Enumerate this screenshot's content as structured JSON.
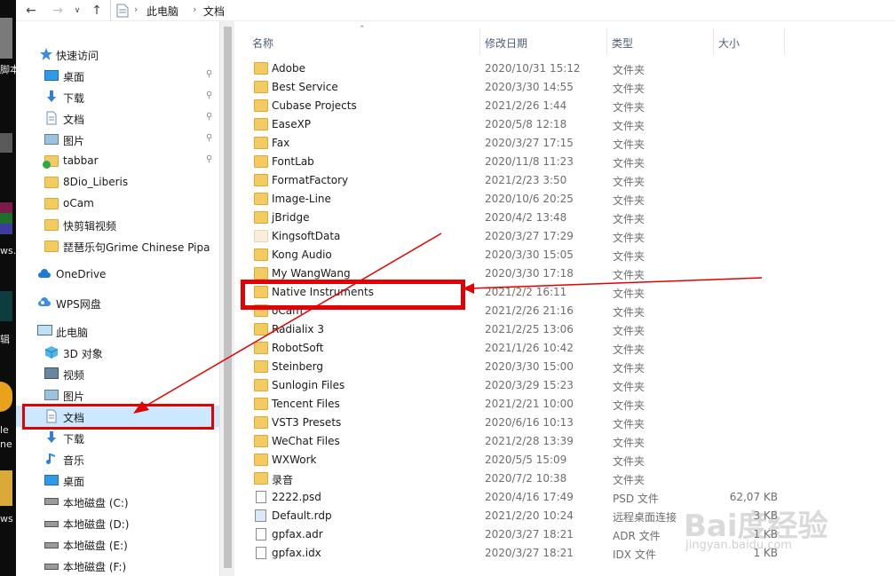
{
  "desktop": {
    "fragments": [
      "脚本",
      "ws...",
      "辑",
      "le",
      "ne",
      "ws"
    ]
  },
  "address": {
    "crumbs": [
      "此电脑",
      "文档"
    ]
  },
  "nav": {
    "quick_access": "快速访问",
    "quick_items": [
      "桌面",
      "下载",
      "文档",
      "图片",
      "tabbar",
      "8Dio_Liberis",
      "oCam",
      "快剪辑视频",
      "琵琶乐句Grime Chinese Pipa"
    ],
    "onedrive": "OneDrive",
    "wps": "WPS网盘",
    "this_pc": "此电脑",
    "pc_items": [
      "3D 对象",
      "视频",
      "图片",
      "文档",
      "下载",
      "音乐",
      "桌面",
      "本地磁盘 (C:)",
      "本地磁盘 (D:)",
      "本地磁盘 (E:)",
      "本地磁盘 (F:)"
    ],
    "selected": "文档"
  },
  "columns": {
    "name": "名称",
    "date": "修改日期",
    "type": "类型",
    "size": "大小"
  },
  "files": [
    {
      "name": "Adobe",
      "date": "2020/10/31 15:12",
      "type": "文件夹",
      "size": "",
      "icon": "folder-icon"
    },
    {
      "name": "Best Service",
      "date": "2020/3/30 14:55",
      "type": "文件夹",
      "size": "",
      "icon": "folder-icon"
    },
    {
      "name": "Cubase Projects",
      "date": "2021/2/26 1:44",
      "type": "文件夹",
      "size": "",
      "icon": "folder-icon"
    },
    {
      "name": "EaseXP",
      "date": "2020/5/8 12:18",
      "type": "文件夹",
      "size": "",
      "icon": "folder-icon"
    },
    {
      "name": "Fax",
      "date": "2020/3/27 17:15",
      "type": "文件夹",
      "size": "",
      "icon": "folder-icon"
    },
    {
      "name": "FontLab",
      "date": "2020/11/8 11:23",
      "type": "文件夹",
      "size": "",
      "icon": "folder-icon"
    },
    {
      "name": "FormatFactory",
      "date": "2021/2/23 3:50",
      "type": "文件夹",
      "size": "",
      "icon": "folder-icon"
    },
    {
      "name": "Image-Line",
      "date": "2020/10/6 20:25",
      "type": "文件夹",
      "size": "",
      "icon": "folder-icon"
    },
    {
      "name": "jBridge",
      "date": "2020/4/2 13:48",
      "type": "文件夹",
      "size": "",
      "icon": "folder-icon"
    },
    {
      "name": "KingsoftData",
      "date": "2020/3/27 17:29",
      "type": "文件夹",
      "size": "",
      "icon": "folder-pale-icon"
    },
    {
      "name": "Kong Audio",
      "date": "2020/3/30 15:05",
      "type": "文件夹",
      "size": "",
      "icon": "folder-icon"
    },
    {
      "name": "My WangWang",
      "date": "2020/3/30 17:18",
      "type": "文件夹",
      "size": "",
      "icon": "folder-icon"
    },
    {
      "name": "Native Instruments",
      "date": "2021/2/2 16:11",
      "type": "文件夹",
      "size": "",
      "icon": "folder-icon"
    },
    {
      "name": "oCam",
      "date": "2021/2/26 21:16",
      "type": "文件夹",
      "size": "",
      "icon": "folder-icon"
    },
    {
      "name": "Radialix 3",
      "date": "2021/2/25 13:06",
      "type": "文件夹",
      "size": "",
      "icon": "folder-icon"
    },
    {
      "name": "RobotSoft",
      "date": "2021/1/26 10:42",
      "type": "文件夹",
      "size": "",
      "icon": "folder-icon"
    },
    {
      "name": "Steinberg",
      "date": "2020/3/30 15:00",
      "type": "文件夹",
      "size": "",
      "icon": "folder-icon"
    },
    {
      "name": "Sunlogin Files",
      "date": "2020/3/29 15:23",
      "type": "文件夹",
      "size": "",
      "icon": "folder-icon"
    },
    {
      "name": "Tencent Files",
      "date": "2021/2/21 10:00",
      "type": "文件夹",
      "size": "",
      "icon": "folder-icon"
    },
    {
      "name": "VST3 Presets",
      "date": "2020/6/16 10:13",
      "type": "文件夹",
      "size": "",
      "icon": "folder-icon"
    },
    {
      "name": "WeChat Files",
      "date": "2021/2/28 13:39",
      "type": "文件夹",
      "size": "",
      "icon": "folder-icon"
    },
    {
      "name": "WXWork",
      "date": "2020/5/5 15:09",
      "type": "文件夹",
      "size": "",
      "icon": "folder-icon"
    },
    {
      "name": "录音",
      "date": "2020/7/2 10:38",
      "type": "文件夹",
      "size": "",
      "icon": "folder-icon"
    },
    {
      "name": "2222.psd",
      "date": "2020/4/16 17:49",
      "type": "PSD 文件",
      "size": "62,07 KB",
      "icon": "psd-file-icon"
    },
    {
      "name": "Default.rdp",
      "date": "2021/2/20 10:24",
      "type": "远程桌面连接",
      "size": "3 KB",
      "icon": "rdp-file-icon"
    },
    {
      "name": "gpfax.adr",
      "date": "2020/3/27 18:21",
      "type": "ADR 文件",
      "size": "1 KB",
      "icon": "file-icon"
    },
    {
      "name": "gpfax.idx",
      "date": "2020/3/27 18:21",
      "type": "IDX 文件",
      "size": "1 KB",
      "icon": "file-icon"
    }
  ],
  "watermark": {
    "logo": "Bai度经验",
    "url": "jingyan.baidu.com"
  },
  "colors": {
    "annotation": "#e40000",
    "selection": "#cce8ff",
    "folder": "#f4cb63"
  }
}
